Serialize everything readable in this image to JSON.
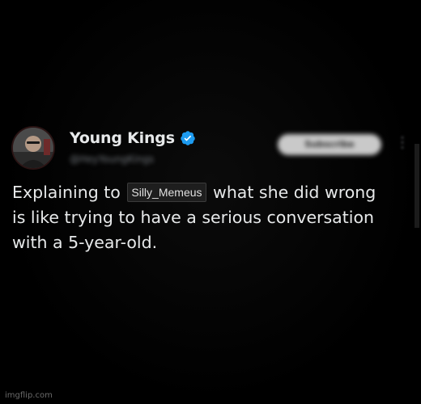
{
  "author": {
    "display_name": "Young Kings",
    "handle": "@HeyYoungKings",
    "verified": true,
    "verified_color": "#1d9bf0",
    "avatar_icon": "profile-photo"
  },
  "actions": {
    "subscribe_label": "Subscribe",
    "more_icon": "more-dots-icon"
  },
  "tweet": {
    "text_before": "Explaining to",
    "tag": "Silly_Memeus",
    "text_after": "what she did wrong is like trying to have a serious conversation with a 5-year-old."
  },
  "watermark": "imgflip.com",
  "colors": {
    "background": "#000000",
    "text": "#e7e9ea",
    "muted": "#71767b"
  }
}
